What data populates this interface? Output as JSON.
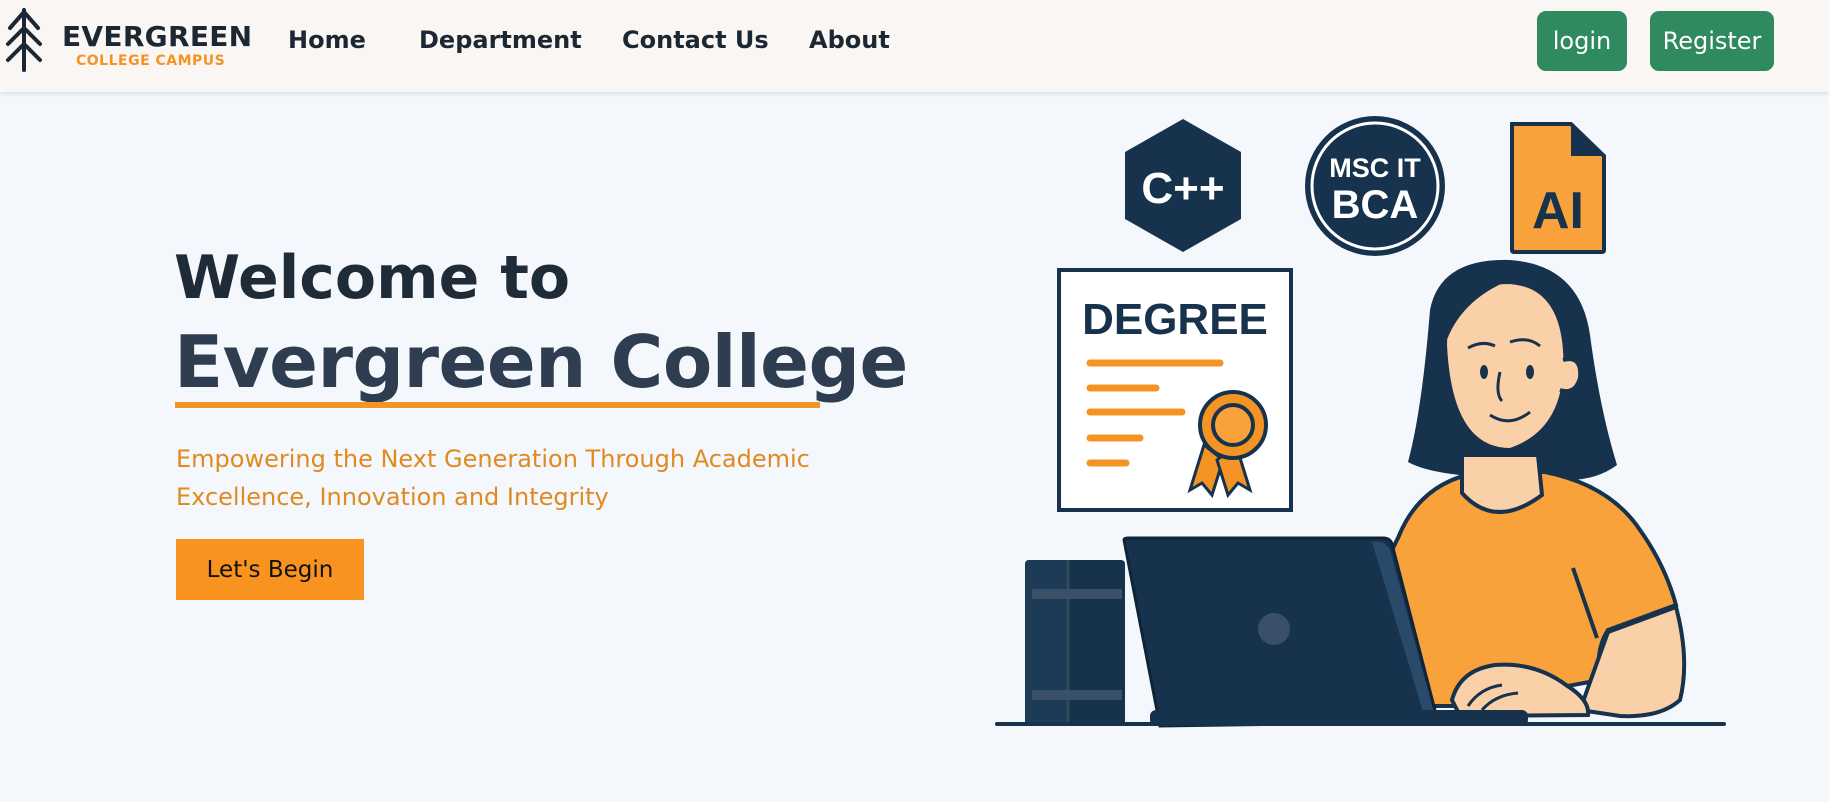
{
  "brand": {
    "name": "EVERGREEN",
    "subtitle": "COLLEGE CAMPUS",
    "logo_icon": "tree-icon"
  },
  "nav": {
    "items": [
      {
        "label": "Home"
      },
      {
        "label": "Department"
      },
      {
        "label": "Contact Us"
      },
      {
        "label": "About"
      }
    ],
    "login_label": "login",
    "register_label": "Register"
  },
  "hero": {
    "welcome": "Welcome to",
    "title": "Evergreen College",
    "tagline": "Empowering the Next Generation Through Academic Excellence, Innovation and Integrity",
    "cta_label": "Let's Begin"
  },
  "illustration": {
    "badges": {
      "cpp": "C++",
      "msc": "MSC IT",
      "bca": "BCA",
      "ai": "AI"
    },
    "certificate_title": "DEGREE"
  },
  "colors": {
    "accent_orange": "#f39424",
    "button_green": "#2f8a5f",
    "navy": "#17324d",
    "nav_bg": "#f9f6f3",
    "page_bg": "#f4f8fc"
  }
}
